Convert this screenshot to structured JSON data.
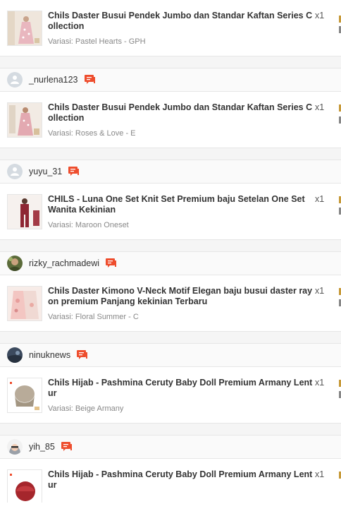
{
  "orders": [
    {
      "show_header": false,
      "buyer": "",
      "item": {
        "name": "Chils Daster Busui Pendek Jumbo dan Standar Kaftan Series Collection",
        "variation": "Variasi: Pastel Hearts - GPH",
        "quantity": "x1"
      }
    },
    {
      "show_header": true,
      "buyer": "_nurlena123",
      "avatar": "default-user-icon",
      "item": {
        "name": "Chils Daster Busui Pendek Jumbo dan Standar Kaftan Series Collection",
        "variation": "Variasi: Roses & Love - E",
        "quantity": "x1"
      }
    },
    {
      "show_header": true,
      "buyer": "yuyu_31",
      "avatar": "default-user-icon",
      "item": {
        "name": "CHILS - Luna One Set Knit Set Premium baju Setelan One Set Wanita Kekinian",
        "variation": "Variasi: Maroon Oneset",
        "quantity": "x1"
      }
    },
    {
      "show_header": true,
      "buyer": "rizky_rachmadewi",
      "avatar": "photo-avatar",
      "item": {
        "name": "Chils Daster Kimono V-Neck Motif Elegan baju busui daster rayon premium Panjang kekinian Terbaru",
        "variation": "Variasi: Floral Summer - C",
        "quantity": "x1"
      }
    },
    {
      "show_header": true,
      "buyer": "ninuknews",
      "avatar": "photo-avatar",
      "item": {
        "name": "Chils Hijab - Pashmina Ceruty Baby Doll Premium Armany Lentur",
        "variation": "Variasi: Beige Armany",
        "quantity": "x1"
      }
    },
    {
      "show_header": true,
      "buyer": "yih_85",
      "avatar": "photo-avatar",
      "item": {
        "name": "Chils Hijab - Pashmina Ceruty Baby Doll Premium Armany Lentur",
        "variation": "",
        "quantity": "x1"
      }
    }
  ],
  "colors": {
    "chat_icon": "#ee4d2d",
    "header_bg": "#fafafa",
    "item_bg": "#ffffff",
    "page_bg": "#f5f5f5"
  }
}
